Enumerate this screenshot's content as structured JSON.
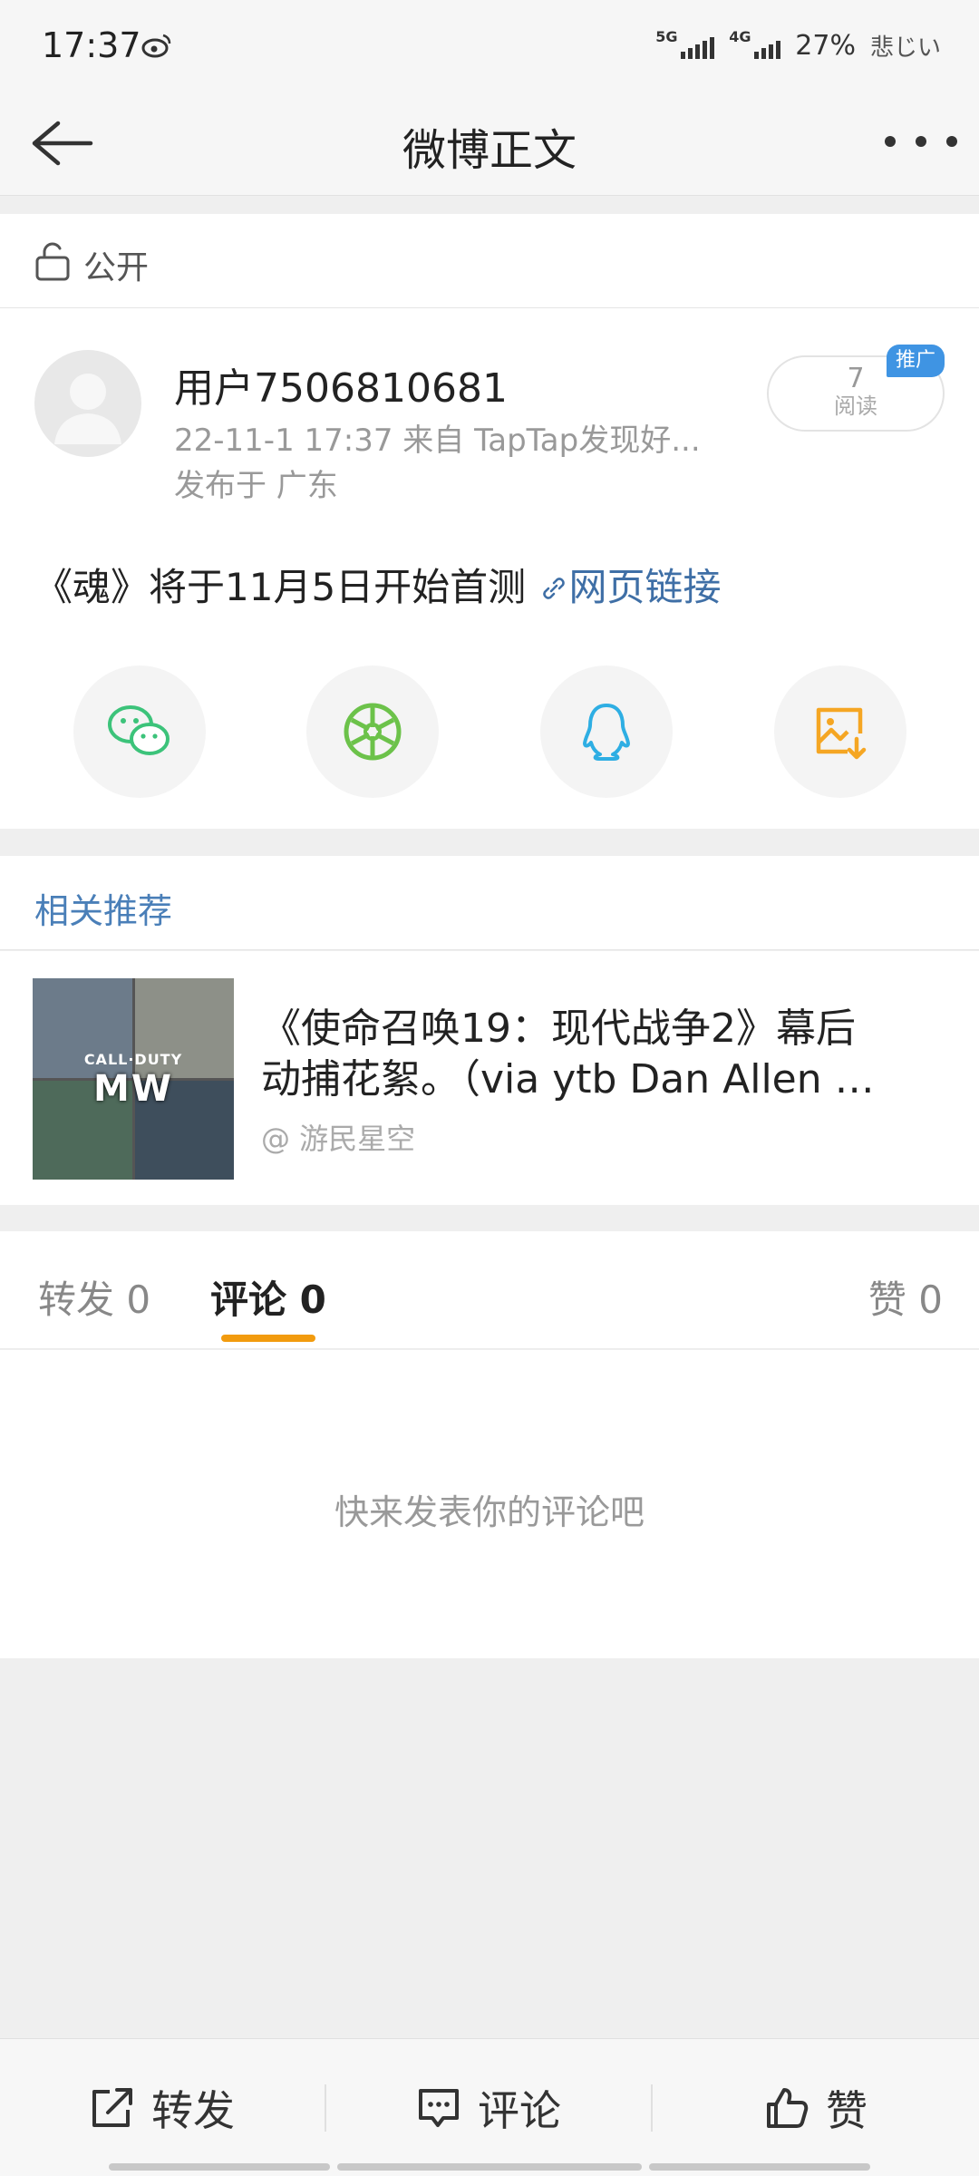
{
  "status_bar": {
    "time": "17:37",
    "net1": "5G",
    "net2": "4G",
    "battery": "27%",
    "note": "悲じい"
  },
  "nav": {
    "title": "微博正文"
  },
  "privacy": {
    "label": "公开"
  },
  "post": {
    "username": "用户7506810681",
    "meta": "22-11-1 17:37  来自 TapTap发现好...",
    "location": "发布于 广东",
    "reads_count": "7",
    "reads_label": "阅读",
    "promo_badge": "推广",
    "text": "《魂》将于11月5日开始首测 ",
    "link_text": "网页链接",
    "share_icons": [
      "wechat-icon",
      "moments-icon",
      "qq-icon",
      "save-image-icon"
    ]
  },
  "related": {
    "header": "相关推荐",
    "item": {
      "title_line1": "《使命召唤19：现代战争2》幕后",
      "title_line2": "动捕花絮。（via ytb Dan Allen …",
      "source": "@ 游民星空",
      "thumb_logo_top": "CALL·DUTY",
      "thumb_logo_main": "MW"
    }
  },
  "tabs": {
    "repost": "转发 0",
    "comment": "评论 0",
    "like": "赞 0",
    "active": "comment"
  },
  "comments": {
    "empty_text": "快来发表你的评论吧"
  },
  "bottom_bar": {
    "repost": "转发",
    "comment": "评论",
    "like": "赞"
  },
  "colors": {
    "link": "#3f6fa6",
    "tab_accent": "#f29b0e",
    "promo": "#3f94e3",
    "wechat": "#3cc37a",
    "moments": "#6cc24a",
    "qq": "#2eaee3",
    "save": "#f5a623"
  }
}
